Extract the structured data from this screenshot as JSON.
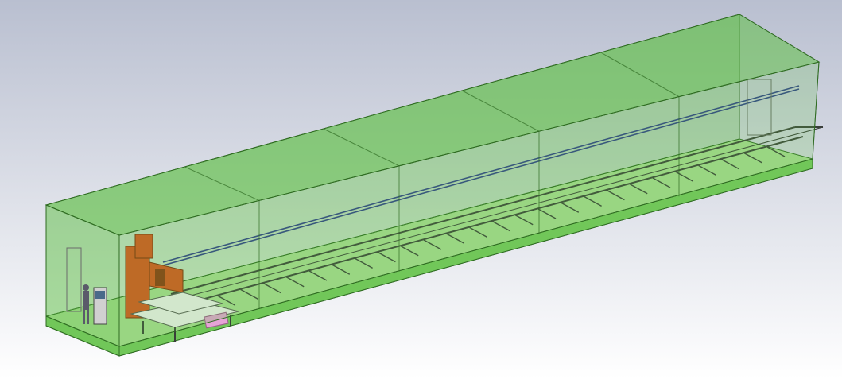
{
  "scene": {
    "kind": "isometric-cad-model",
    "colors": {
      "background_top": "#b9bfd0",
      "background_bottom": "#ffffff",
      "enclosure_fill": "#5fbf46",
      "enclosure_stroke": "#2f6b22",
      "floor_fill": "#a9dd94",
      "rail_steel": "#3a3f3a",
      "guide_rail": "#2d3b8c",
      "robot_orange": "#d9531e",
      "table_white": "#f2f2f2",
      "pallet_pink": "#e6a4d6",
      "fence_grey": "#6b6b6b"
    },
    "parts": [
      "enclosure",
      "floor-slab",
      "conveyor-line",
      "overhead-guide-rail",
      "cutting-robot",
      "infeed-table",
      "control-cabinet",
      "operator-figure",
      "safety-fence",
      "pink-pallet"
    ]
  }
}
